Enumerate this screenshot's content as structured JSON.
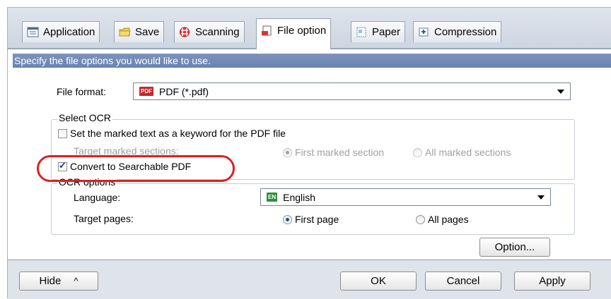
{
  "tabs": [
    {
      "label": "Application",
      "icon": "application-icon"
    },
    {
      "label": "Save",
      "icon": "folder-icon"
    },
    {
      "label": "Scanning",
      "icon": "scanning-icon"
    },
    {
      "label": "File option",
      "icon": "file-option-icon",
      "active": true
    },
    {
      "label": "Paper",
      "icon": "paper-icon"
    },
    {
      "label": "Compression",
      "icon": "compression-icon"
    }
  ],
  "banner": "Specify the file options you would like to use.",
  "file_format": {
    "label": "File format:",
    "badge": "PDF",
    "value": "PDF (*.pdf)"
  },
  "select_ocr": {
    "title": "Select OCR",
    "keyword_checkbox": {
      "label": "Set the marked text as a keyword for the PDF file",
      "checked": false
    },
    "target_marked_label": "Target marked sections:",
    "first_marked": "First marked section",
    "all_marked": "All marked sections",
    "searchable_checkbox": {
      "label": "Convert to Searchable PDF",
      "checked": true
    }
  },
  "ocr_options": {
    "title": "OCR options",
    "language_label": "Language:",
    "language_badge": "EN",
    "language_value": "English",
    "target_pages_label": "Target pages:",
    "first_page": "First page",
    "all_pages": "All pages"
  },
  "option_button": "Option...",
  "footer": {
    "hide": "Hide",
    "hide_arrow": "^",
    "ok": "OK",
    "cancel": "Cancel",
    "apply": "Apply"
  },
  "colors": {
    "banner": "#7d93bd",
    "highlight": "#e02020",
    "pdf_badge": "#c8262b",
    "en_badge": "#2f8f3a"
  }
}
